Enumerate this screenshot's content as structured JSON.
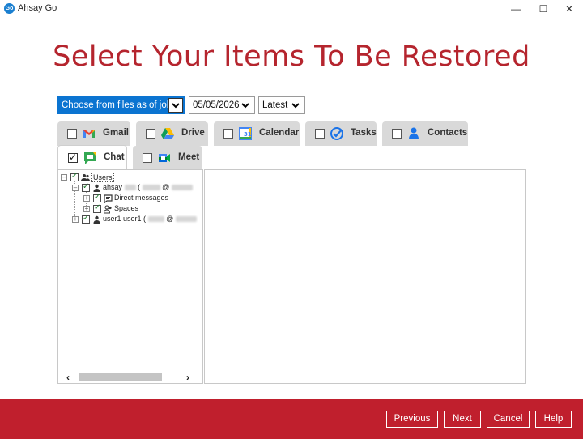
{
  "window": {
    "app_title": "Ahsay Go",
    "logo_text": "Go"
  },
  "page": {
    "title": "Select Your Items To Be Restored"
  },
  "selectors": {
    "job_mode": "Choose from files as of job",
    "date": "05/05/2026",
    "version": "Latest"
  },
  "tabs": [
    {
      "label": "Gmail",
      "checked": false,
      "icon": "gmail-icon"
    },
    {
      "label": "Drive",
      "checked": false,
      "icon": "drive-icon"
    },
    {
      "label": "Calendar",
      "checked": false,
      "icon": "calendar-icon"
    },
    {
      "label": "Tasks",
      "checked": false,
      "icon": "tasks-icon"
    },
    {
      "label": "Contacts",
      "checked": false,
      "icon": "contacts-icon"
    },
    {
      "label": "Chat",
      "checked": true,
      "active": true,
      "icon": "chat-icon"
    },
    {
      "label": "Meet",
      "checked": false,
      "icon": "meet-icon"
    }
  ],
  "tree": {
    "root": "Users",
    "users": [
      {
        "label": "ahsay",
        "email_sep": "(",
        "at": "@",
        "children": [
          "Direct messages",
          "Spaces"
        ]
      },
      {
        "label": "user1 user1",
        "email_sep": "(",
        "at": "@"
      }
    ]
  },
  "footer": {
    "previous": "Previous",
    "next": "Next",
    "cancel": "Cancel",
    "help": "Help"
  },
  "colors": {
    "brand_red": "#c01f2d",
    "title_red": "#b5252e",
    "selected_blue": "#0b74d1"
  }
}
